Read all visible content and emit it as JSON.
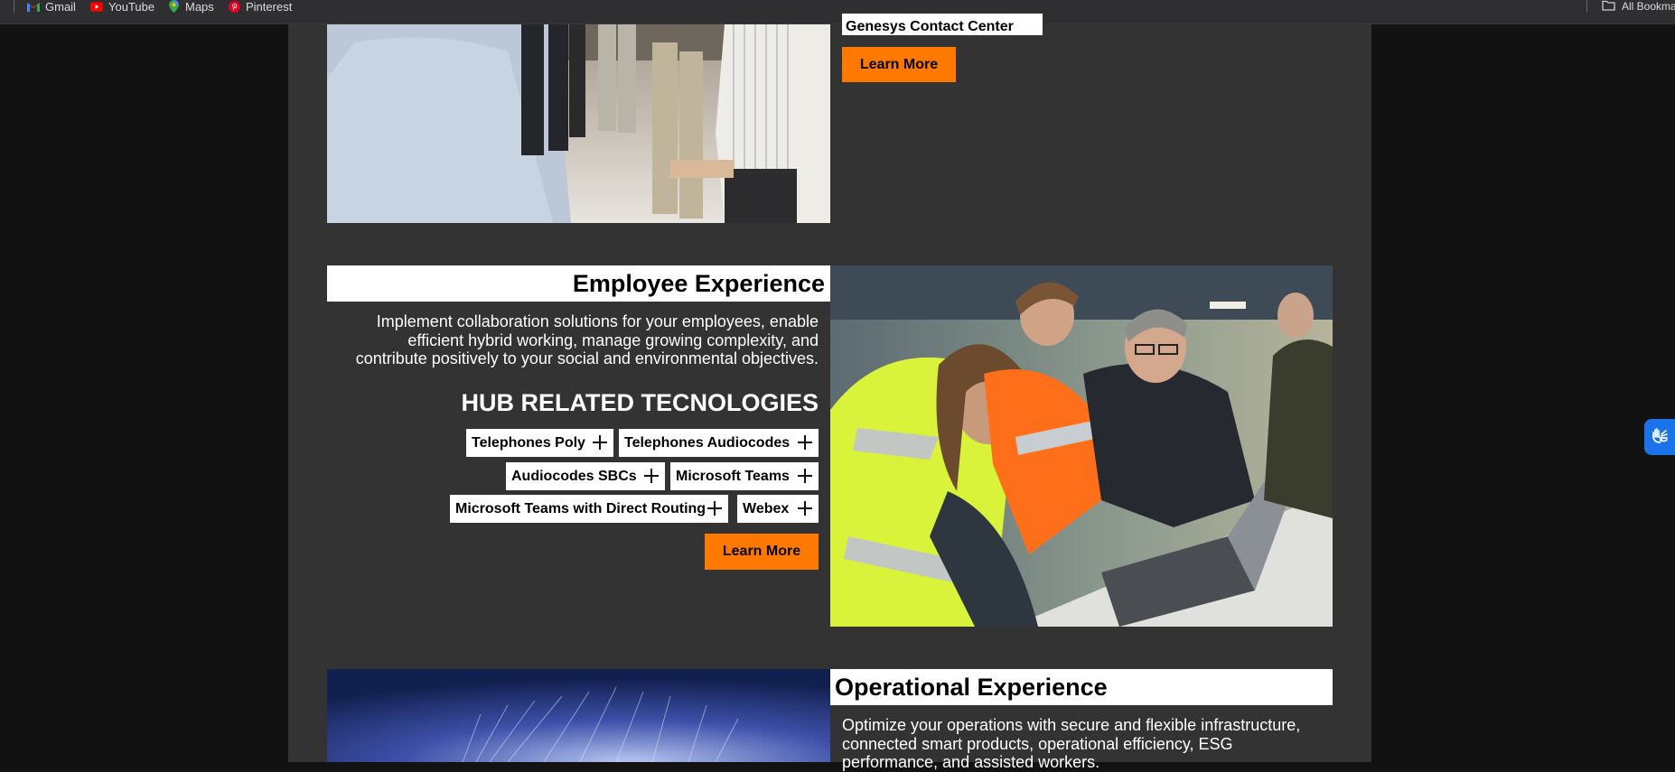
{
  "bookmarks": {
    "items": [
      {
        "label": "Gmail",
        "icon": "gmail-icon"
      },
      {
        "label": "YouTube",
        "icon": "youtube-icon"
      },
      {
        "label": "Maps",
        "icon": "maps-icon"
      },
      {
        "label": "Pinterest",
        "icon": "pinterest-icon"
      }
    ],
    "all_bookmarks": "All Bookma"
  },
  "top_section": {
    "partial_tag": "Genesys Contact Center",
    "learn_more": "Learn More"
  },
  "employee_experience": {
    "title": "Employee Experience",
    "description": "Implement collaboration solutions for your employees, enable efficient hybrid working, manage growing complexity, and contribute positively to your social and environmental objectives.",
    "hub_title": "HUB RELATED TECNOLOGIES",
    "tags": [
      "Telephones Poly",
      "Telephones Audiocodes",
      "Audiocodes SBCs",
      "Microsoft Teams",
      "Microsoft Teams with Direct Routing",
      "Webex"
    ],
    "learn_more": "Learn More"
  },
  "operational_experience": {
    "title": "Operational Experience",
    "description": "Optimize your operations with secure and flexible infrastructure, connected smart products, operational efficiency, ESG performance, and assisted workers."
  },
  "colors": {
    "accent": "#ff7900",
    "page_bg": "#333333",
    "outer_bg": "#121212"
  }
}
